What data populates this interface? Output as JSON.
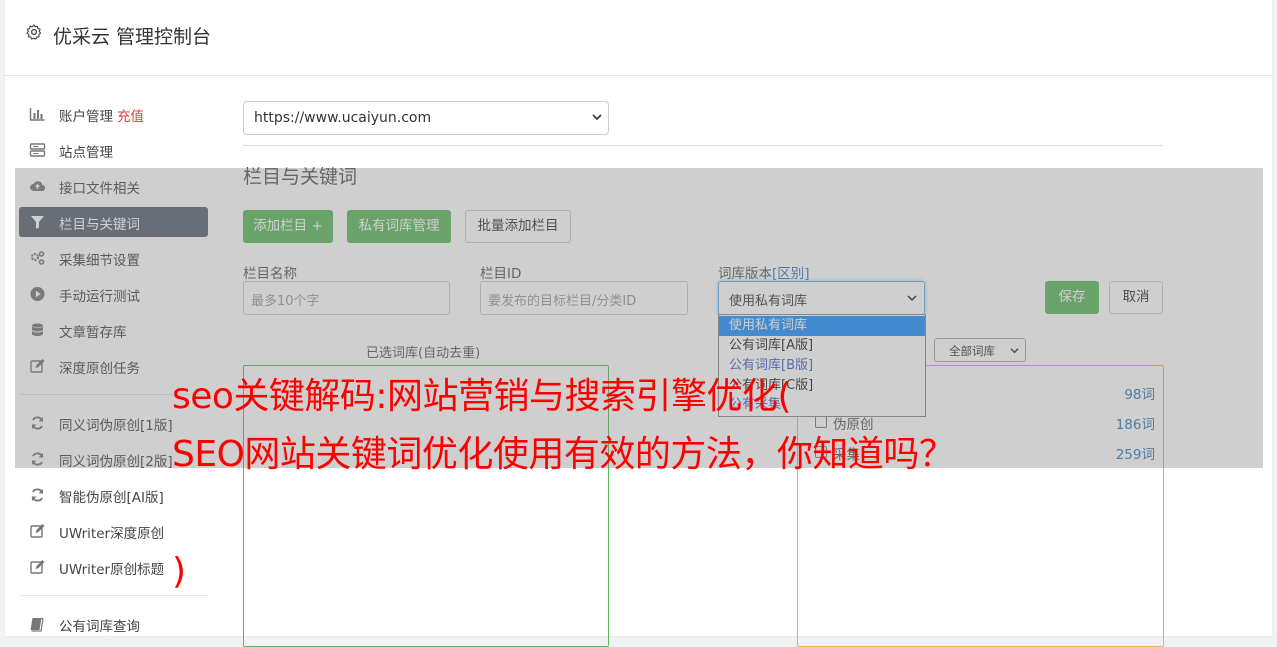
{
  "header": {
    "icon": "gear-icon",
    "title": "优采云 管理控制台"
  },
  "sidebar": {
    "items": [
      {
        "icon": "bar-chart-icon",
        "label": "账户管理",
        "badge": "充值"
      },
      {
        "icon": "server-icon",
        "label": "站点管理"
      },
      {
        "icon": "cloud-upload-icon",
        "label": "接口文件相关"
      },
      {
        "icon": "filter-icon",
        "label": "栏目与关键词",
        "active": true
      },
      {
        "icon": "cogs-icon",
        "label": "采集细节设置"
      },
      {
        "icon": "play-circle-icon",
        "label": "手动运行测试"
      },
      {
        "icon": "database-icon",
        "label": "文章暂存库"
      },
      {
        "icon": "edit-icon",
        "label": "深度原创任务"
      },
      {
        "icon": "refresh-icon",
        "label": "同义词伪原创[1版]"
      },
      {
        "icon": "refresh-icon",
        "label": "同义词伪原创[2版]"
      },
      {
        "icon": "refresh-icon",
        "label": "智能伪原创[AI版]"
      },
      {
        "icon": "edit-icon",
        "label": "UWriter深度原创"
      },
      {
        "icon": "edit-icon",
        "label": "UWriter原创标题"
      },
      {
        "icon": "book-icon",
        "label": "公有词库查询"
      }
    ]
  },
  "main": {
    "site_select": "https://www.ucaiyun.com",
    "section_title": "栏目与关键词",
    "buttons": {
      "add_column": "添加栏目 +",
      "private_lib": "私有词库管理",
      "batch_add": "批量添加栏目",
      "save": "保存",
      "cancel": "取消"
    },
    "fields": {
      "column_name": {
        "label": "栏目名称",
        "placeholder": "最多10个字"
      },
      "column_id": {
        "label": "栏目ID",
        "placeholder": "要发布的目标栏目/分类ID"
      },
      "lib_version": {
        "label": "词库版本",
        "link": "[区别]",
        "value": "使用私有词库"
      }
    },
    "dropdown_options": [
      "使用私有词库",
      "公有词库[A版]",
      "公有词库[B版]",
      "公有词库[C版]",
      "公有采集"
    ],
    "selected_title": "已选词库(自动去重)",
    "filter_select": "全部词库",
    "libraries": [
      {
        "name": "",
        "count": "98词"
      },
      {
        "name": "伪原创",
        "count": "186词"
      },
      {
        "name": "采集",
        "count": "259词"
      }
    ]
  },
  "watermark": {
    "line1": "seo关键解码:网站营销与搜索引擎优化(",
    "line2": "SEO网站关键词优化使用有效的方法，你知道吗？",
    "line3": ")"
  },
  "colors": {
    "accent_green": "#5cb85c",
    "active_nav": "#5a6270",
    "recharge_red": "#e4393c",
    "watermark_red": "#ff0000"
  }
}
